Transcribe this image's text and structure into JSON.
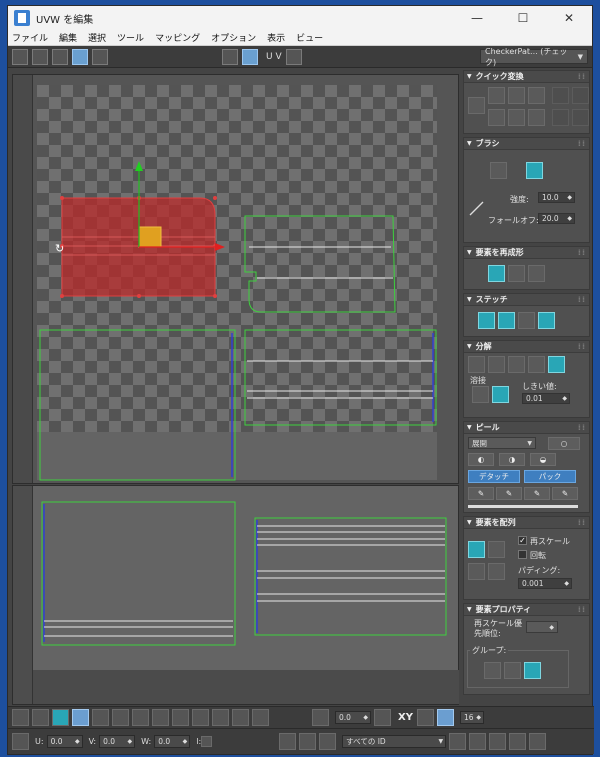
{
  "window": {
    "title": "UVW を編集",
    "minimize": "—",
    "maximize": "☐",
    "close": "✕"
  },
  "menu": [
    "ファイル",
    "編集",
    "選択",
    "ツール",
    "マッピング",
    "オプション",
    "表示",
    "ビュー"
  ],
  "toolbar": {
    "uv_label": "U V",
    "texture_dropdown": "CheckerPat... (チェック)"
  },
  "panel": {
    "quick_transform": {
      "title": "クイック変換"
    },
    "brush": {
      "title": "ブラシ",
      "strength_label": "強度:",
      "strength_value": "10.0",
      "falloff_label": "フォールオフ:",
      "falloff_value": "20.0"
    },
    "reshape": {
      "title": "要素を再成形"
    },
    "stitch": {
      "title": "ステッチ"
    },
    "explode": {
      "title": "分解",
      "weld_label": "溶接",
      "threshold_label": "しきい値:",
      "threshold_value": "0.01"
    },
    "peel": {
      "title": "ピール",
      "mode_dropdown": "展開",
      "detach_button": "デタッチ",
      "pack_button": "パック"
    },
    "arrange": {
      "title": "要素を配列",
      "rescale_label": "再スケール",
      "rotate_label": "回転",
      "padding_label": "パディング:",
      "padding_value": "0.001"
    },
    "element_props": {
      "title": "要素プロパティ",
      "rescale_priority_label_1": "再スケール優",
      "rescale_priority_label_2": "先順位:",
      "groups_label": "グループ:"
    }
  },
  "bottom_toolbar": {
    "angle_value": "0.0",
    "xy_label": "XY",
    "grid_value": "16"
  },
  "status": {
    "u_label": "U:",
    "u_value": "0.0",
    "v_label": "V:",
    "v_value": "0.0",
    "w_label": "W:",
    "w_value": "0.0",
    "l_label": "l:",
    "id_dropdown": "すべての ID"
  }
}
